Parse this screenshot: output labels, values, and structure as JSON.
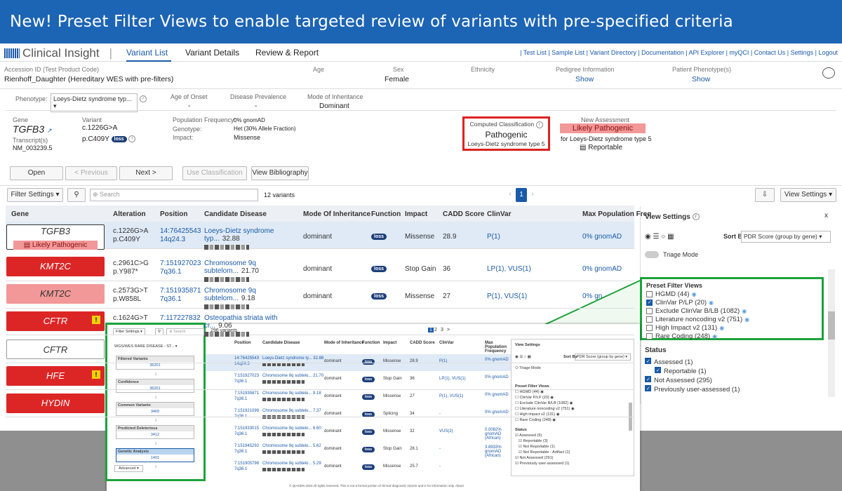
{
  "banner": "New! Preset Filter Views to enable targeted review of variants with pre-specified criteria",
  "app": {
    "logo": "Clinical Insight",
    "tabs": [
      "Variant List",
      "Variant Details",
      "Review & Report"
    ],
    "links": "| Test List | Sample List | Variant Directory | Documentation | API Explorer | myQCI | Contact Us | Settings | Logout"
  },
  "header": {
    "acc_label": "Accession ID (Test Product Code)",
    "acc_value": "Rienhoff_Daughter  (Hereditary WES with pre-filters)",
    "age_label": "Age",
    "sex_label": "Sex",
    "sex_value": "Female",
    "eth_label": "Ethnicity",
    "ped_label": "Pedigree Information",
    "ped_value": "Show",
    "phe_label": "Patient Phenotype(s)",
    "phe_value": "Show"
  },
  "phen": {
    "label": "Phenotype:",
    "value": "Loeys-Dietz syndrome typ...",
    "onset_label": "Age of Onset",
    "onset_value": "-",
    "prev_label": "Disease Prevalence",
    "prev_value": "-",
    "moi_label": "Mode of Inheritance",
    "moi_value": "Dominant"
  },
  "variant": {
    "gene_label": "Gene",
    "gene": "TGFB3",
    "tr_label": "Transcript(s)",
    "tr": "NM_003239.5",
    "var_label": "Variant",
    "c": "c.1226G>A",
    "p": "p.C409Y",
    "loss": "loss",
    "pf_label": "Population Frequency:",
    "pf": "0% gnomAD",
    "gt_label": "Genotype:",
    "gt": "Het (30% Allele Fraction)",
    "imp_label": "Impact:",
    "imp": "Missense",
    "cc_label": "Computed Classification",
    "cc": "Pathogenic",
    "cc_dis": "Loeys-Dietz syndrome type 5",
    "na_label": "New Assessment",
    "na": "Likely Pathogenic",
    "na_dis": "for Loeys-Dietz syndrome type 5",
    "na_rep": "Reportable"
  },
  "buttons": {
    "open": "Open",
    "prev": "< Previous",
    "next": "Next >",
    "use": "Use Classification",
    "bib": "View Bibliography",
    "filter": "Filter Settings ▾",
    "search": "Search",
    "count": "12 variants",
    "page": "1",
    "view": "View Settings ▾"
  },
  "cols": [
    "Gene",
    "Alteration",
    "Position",
    "Candidate Disease",
    "Mode Of Inheritance",
    "Function",
    "Impact",
    "CADD Score",
    "ClinVar",
    "Max Population Freq"
  ],
  "rows": [
    {
      "gene": "TGFB3",
      "tag": "Likely Pathogenic",
      "c": "c.1226G>A",
      "p": "p.C409Y",
      "pos": "14:76425543",
      "band": "14q24.3",
      "dis": "Loeys-Dietz syndrome typ...",
      "score": "32.88",
      "moi": "dominant",
      "imp": "Missense",
      "cadd": "28.9",
      "cv": "P(1)",
      "freq": "0% gnomAD"
    },
    {
      "gene": "KMT2C",
      "c": "c.2961C>G",
      "p": "p.Y987*",
      "pos": "7:151927023",
      "band": "7q36.1",
      "dis": "Chromosome 9q subtelom...",
      "score": "21.70",
      "moi": "dominant",
      "imp": "Stop Gain",
      "cadd": "36",
      "cv": "LP(1), VUS(1)",
      "freq": "0% gnomAD"
    },
    {
      "gene": "KMT2C",
      "c": "c.2573G>T",
      "p": "p.W858L",
      "pos": "7:151935871",
      "band": "7q36.1",
      "dis": "Chromosome 9q subtelom...",
      "score": "9.18",
      "moi": "dominant",
      "imp": "Missense",
      "cadd": "27",
      "cv": "P(1), VUS(1)",
      "freq": "0% gn"
    },
    {
      "gene": "CFTR",
      "c": "c.1624G>T",
      "pos": "7:117227832",
      "dis": "Osteopathia striata with cr...",
      "score": "9.06"
    },
    {
      "gene": "CFTR"
    },
    {
      "gene": "HFE"
    },
    {
      "gene": "HYDIN"
    }
  ],
  "panel": {
    "title": "View Settings",
    "sort": "Sort By",
    "sortval": "PDR Score (group by gene)",
    "triage": "Triage Mode",
    "pfv": "Preset Filter Views",
    "items": [
      "HGMD (44)",
      "ClinVar P/LP (20)",
      "Exclude ClinVar B/LB (1082)",
      "Literature noncoding v2 (751)",
      "High Impact v2 (131)",
      "Rare Coding (248)"
    ],
    "status": "Status",
    "st": [
      "Assessed (1)",
      "Reportable (1)",
      "Not Assessed (295)",
      "Previously user-assessed (1)"
    ]
  },
  "ovl": {
    "filter": "Filter Settings ▾",
    "search": "Search",
    "count": "296 variants",
    "pages": [
      "1",
      "2",
      "3",
      ">"
    ],
    "wg": "WGS/WES RARE DISEASE - ST...",
    "boxes": [
      [
        "Filtered Variants",
        "36201"
      ],
      [
        "Confidence",
        "36201"
      ],
      [
        "Common Variants",
        "3469"
      ],
      [
        "Predicted Deleterious",
        "3412"
      ],
      [
        "Genetic Analysis",
        "1401"
      ]
    ],
    "adv": "Advanced ▾",
    "cols": [
      "Position",
      "Candidate Disease",
      "Mode of Inheritance",
      "Function",
      "Impact",
      "CADD Score",
      "ClinVar",
      "Max Population Frequency"
    ],
    "rows": [
      [
        "14:76425543",
        "14q24.3",
        "Loeys-Dietz syndrome ty...",
        "32.88",
        "dominant",
        "Missense",
        "28.9",
        "P(1)",
        "0% gnomAD"
      ],
      [
        "7:151927023",
        "7q36.1",
        "Chromosome 9q subtelo...",
        "21.70",
        "dominant",
        "Stop Gain",
        "36",
        "LP(1), VUS(1)",
        "0% gnomAD"
      ],
      [
        "7:151935871",
        "7q36.1",
        "Chromosome 9q subtelo...",
        "9.18",
        "dominant",
        "Missense",
        "27",
        "P(1), VUS(1)",
        "0% gnomAD"
      ],
      [
        "7:151921099",
        "7q36.1",
        "Chromosome 9q subtelo...",
        "7.37",
        "dominant",
        "Splicing",
        "34",
        "-",
        "0% gnomAD"
      ],
      [
        "7:151933015",
        "7q36.1",
        "Chromosome 9q subtelo...",
        "6.60",
        "dominant",
        "Missense",
        "32",
        "VUS(2)",
        "0.0082% gnomAD (African)"
      ],
      [
        "7:151945292",
        "7q36.1",
        "Chromosome 9q subtelo...",
        "5.62",
        "dominant",
        "Stop Gain",
        "28.1",
        "-",
        "3.8933% gnomAD (African)"
      ],
      [
        "7:151905798",
        "7q36.1",
        "Chromosome 9q subtelo...",
        "5.29",
        "dominant",
        "Missense",
        "25.7",
        "-",
        ""
      ]
    ],
    "mini_pfv": [
      "HGMD (44)",
      "ClinVar P/LP (20)",
      "Exclude ClinVar B/LB (1082)",
      "Literature noncoding v2 (751)",
      "High impact v2 (131)",
      "Rare Coding (248)"
    ],
    "mini_st": [
      "Assessed (5)",
      "Reportable (3)",
      "Not Reportable (1)",
      "Not Reportable - Artifact (1)",
      "Not Assessed (291)",
      "Previously user-assessed (1)"
    ],
    "footer": "© QIAGEN 2024 All rights reserved. This is not a formal portion of clinical diagnostic reports and is for information only. About"
  },
  "colors": {
    "banner": "#1c64b4",
    "red": "#dc2626",
    "pink": "#f29898",
    "green": "#1ea23c"
  }
}
